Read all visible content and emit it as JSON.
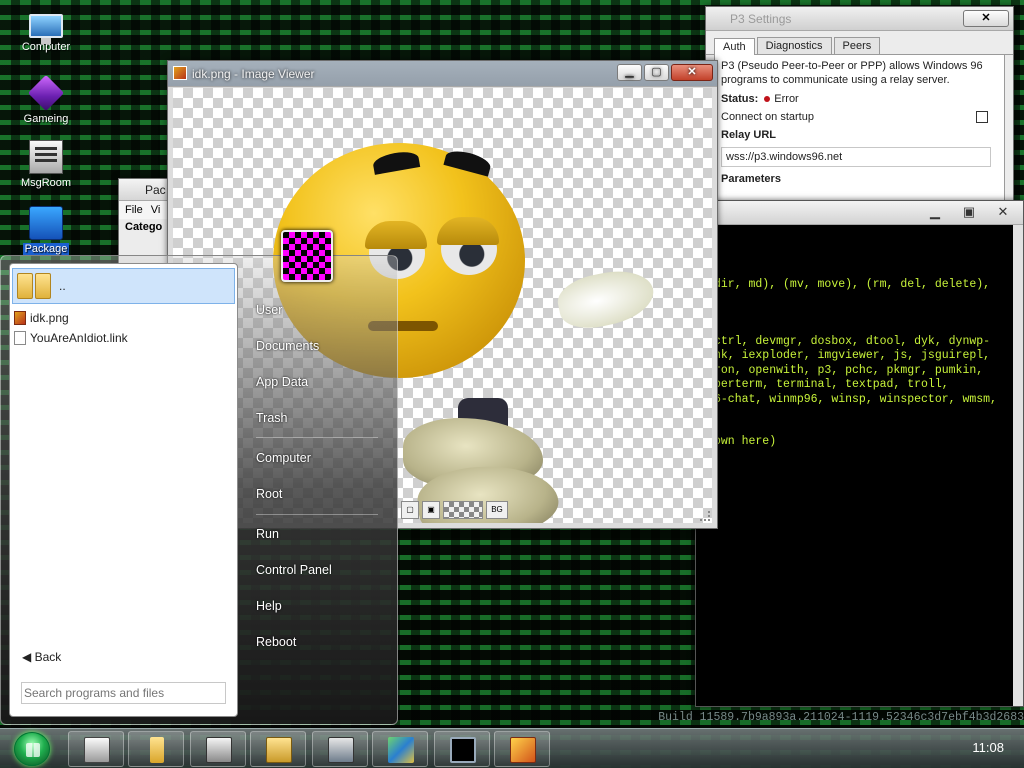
{
  "desktop": {
    "icons": [
      {
        "label": "Computer",
        "icon": "computer-icon"
      },
      {
        "label": "Gameing",
        "icon": "cube-icon"
      },
      {
        "label": "MsgRoom",
        "icon": "msgroom-icon"
      },
      {
        "label": "Package",
        "icon": "package-icon"
      }
    ]
  },
  "p3_settings": {
    "title": "P3 Settings",
    "tabs": [
      "Auth",
      "Diagnostics",
      "Peers"
    ],
    "description": "P3 (Pseudo Peer-to-Peer or PPP) allows Windows 96 programs to communicate using a relay server.",
    "status_label": "Status:",
    "status_value": "Error",
    "connect_label": "Connect on startup",
    "relay_label": "Relay URL",
    "relay_value": "wss://p3.windows96.net",
    "params_label": "Parameters",
    "close_label": "✕"
  },
  "terminal": {
    "lines": [
      "dir, md), (mv, move), (rm, del, delete),",
      "ctrl, devmgr, dosbox, dtool, dyk, dynwp-",
      "nk, iexploder, imgviewer, js, jsguirepl,",
      "ron, openwith, p3, pchc, pkmgr, pumkin,",
      "perterm, terminal, textpad, troll,",
      "6-chat, winmp96, winsp, winspector, wmsm,",
      "own here)"
    ]
  },
  "package_window": {
    "title": "Pac",
    "menu": [
      "File",
      "Vi"
    ],
    "category": "Catego"
  },
  "image_viewer": {
    "title": "idk.png - Image Viewer",
    "bg_button": "BG"
  },
  "start_menu": {
    "parent_label": "..",
    "files": [
      {
        "name": "idk.png",
        "type": "image"
      },
      {
        "name": "YouAreAnIdiot.link",
        "type": "link"
      }
    ],
    "back_label": "◀ Back",
    "search_placeholder": "Search programs and files",
    "items": [
      "User",
      "Documents",
      "App Data",
      "Trash",
      "Computer",
      "Root",
      "Run",
      "Control Panel",
      "Help",
      "Reboot"
    ]
  },
  "taskbar": {
    "clock": "11:08",
    "buttons": [
      "explorer",
      "folder",
      "msgroom",
      "package-manager",
      "network",
      "package-installer",
      "terminal",
      "image-viewer"
    ]
  },
  "build_string": "Build 11589.7b9a893a.211024-1119.52346c3d7ebf4b3d2683"
}
